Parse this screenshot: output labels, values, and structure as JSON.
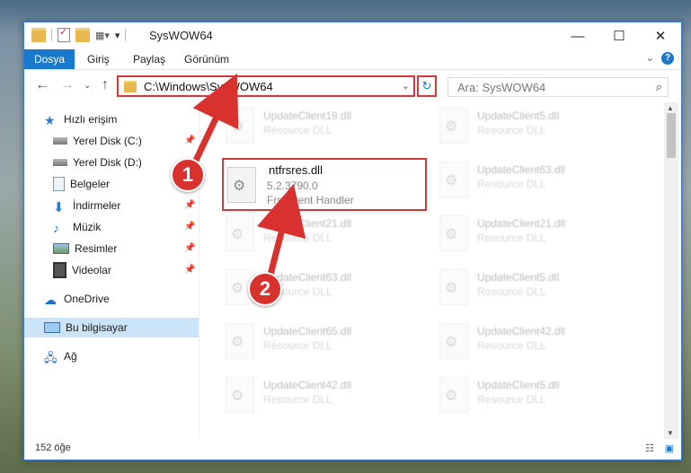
{
  "window": {
    "title": "SysWOW64",
    "controls": {
      "minimize": "—",
      "maximize": "☐",
      "close": "✕"
    }
  },
  "ribbon": {
    "tabs": [
      "Dosya",
      "Giriş",
      "Paylaş",
      "Görünüm"
    ],
    "help": "?"
  },
  "address_bar": {
    "path": "C:\\Windows\\SysWOW64",
    "search_placeholder": "Ara: SysWOW64"
  },
  "sidebar": {
    "items": [
      {
        "label": "Hızlı erişim",
        "icon": "star-icon",
        "pinned": false
      },
      {
        "label": "Yerel Disk (C:)",
        "icon": "drive-icon",
        "pinned": true
      },
      {
        "label": "Yerel Disk (D:)",
        "icon": "drive-icon",
        "pinned": false
      },
      {
        "label": "Belgeler",
        "icon": "document-icon",
        "pinned": true
      },
      {
        "label": "İndirmeler",
        "icon": "download-icon",
        "pinned": true
      },
      {
        "label": "Müzik",
        "icon": "music-icon",
        "pinned": true
      },
      {
        "label": "Resimler",
        "icon": "pictures-icon",
        "pinned": true
      },
      {
        "label": "Videolar",
        "icon": "video-icon",
        "pinned": true
      },
      {
        "label": "OneDrive",
        "icon": "cloud-icon",
        "pinned": false
      },
      {
        "label": "Bu bilgisayar",
        "icon": "computer-icon",
        "pinned": false,
        "selected": true
      },
      {
        "label": "Ağ",
        "icon": "network-icon",
        "pinned": false
      }
    ]
  },
  "files": {
    "highlighted": {
      "name": "ntfrsres.dll",
      "version": "5.2.3790.0",
      "description": "Frs Event Handler"
    },
    "left_column": [
      {
        "name": "UpdateClient19.dll",
        "description": "Resource DLL"
      },
      {
        "name": "UpdateClient21.dll",
        "description": "Resource DLL"
      },
      {
        "name": "UpdateClient63.dll",
        "description": "Resource DLL"
      },
      {
        "name": "UpdateClient65.dll",
        "description": "Resource DLL"
      },
      {
        "name": "UpdateClient42.dll",
        "description": "Resource DLL"
      }
    ],
    "right_column": [
      {
        "name": "UpdateClient5.dll",
        "description": "Resource DLL"
      },
      {
        "name": "UpdateClient63.dll",
        "description": "Resource DLL"
      },
      {
        "name": "UpdateClient21.dll",
        "description": "Resource DLL"
      },
      {
        "name": "UpdateClient5.dll",
        "description": "Resource DLL"
      },
      {
        "name": "UpdateClient42.dll",
        "description": "Resource DLL"
      },
      {
        "name": "UpdateClient5.dll",
        "description": "Resource DLL"
      }
    ]
  },
  "status_bar": {
    "item_count": "152 öğe"
  },
  "annotations": {
    "marker1": "1",
    "marker2": "2",
    "color": "#d9322e"
  },
  "colors": {
    "accent": "#1979ca",
    "highlight_border": "#d23a3a",
    "selected_bg": "#cce4f7"
  }
}
